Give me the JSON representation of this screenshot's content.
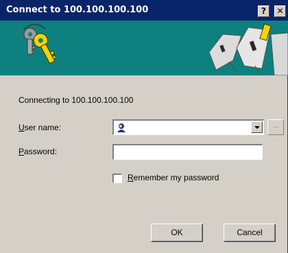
{
  "window": {
    "title": "Connect to 100.100.100.100",
    "help_glyph": "?",
    "close_glyph": "✕"
  },
  "icons": {
    "banner_left": "keys-icon",
    "banner_right": "keyhole-icon",
    "user": "user-avatar-icon",
    "dropdown": "chevron-down-icon"
  },
  "colors": {
    "titlebar": "#0a246a",
    "banner": "#0f8080",
    "dialog": "#d4d0c8"
  },
  "dialog": {
    "connecting_text": "Connecting to 100.100.100.100",
    "username_label_accel": "U",
    "username_label_rest": "ser name:",
    "username_value": "",
    "browse_label": "...",
    "password_label_accel": "P",
    "password_label_rest": "assword:",
    "password_value": "",
    "remember_label_accel": "R",
    "remember_label_rest": "emember my password",
    "remember_checked": false,
    "ok_label": "OK",
    "cancel_label": "Cancel"
  }
}
